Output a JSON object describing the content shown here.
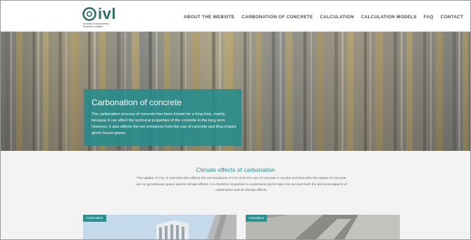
{
  "brand": {
    "name": "ivl",
    "subtitle": "Swedish Environmental\nResearch Institute",
    "color": "#2f6f63"
  },
  "nav": {
    "items": [
      "ABOUT THE WEBSITE",
      "CARBONATION OF CONCRETE",
      "CALCULATION",
      "CALCULATION MODELS",
      "FAQ",
      "CONTACT"
    ],
    "search_icon": "search-icon"
  },
  "hero": {
    "title": "Carbonation of concrete",
    "text": "The carbonation process of concrete has been known for a long time, mainly because it can affect the technical properties of the concrete in the long term. However, it also affects the net emissions from the use of concrete and thus impact green house gases.",
    "box_color": "#268c8c"
  },
  "climate": {
    "title": "Climate effects of carbonation",
    "text": "The uptake of CO₂ in concrete also affects the net emissions of CO₂ from the use of concrete in society and thus also the impact of concrete use on greenhouse gases and its climate effects. It is therefore important to understand and to take into account both the technical aspects of carbonation and its climate effects."
  },
  "cards": [
    {
      "tag": "Carbonation"
    },
    {
      "tag": "Calculation"
    }
  ]
}
